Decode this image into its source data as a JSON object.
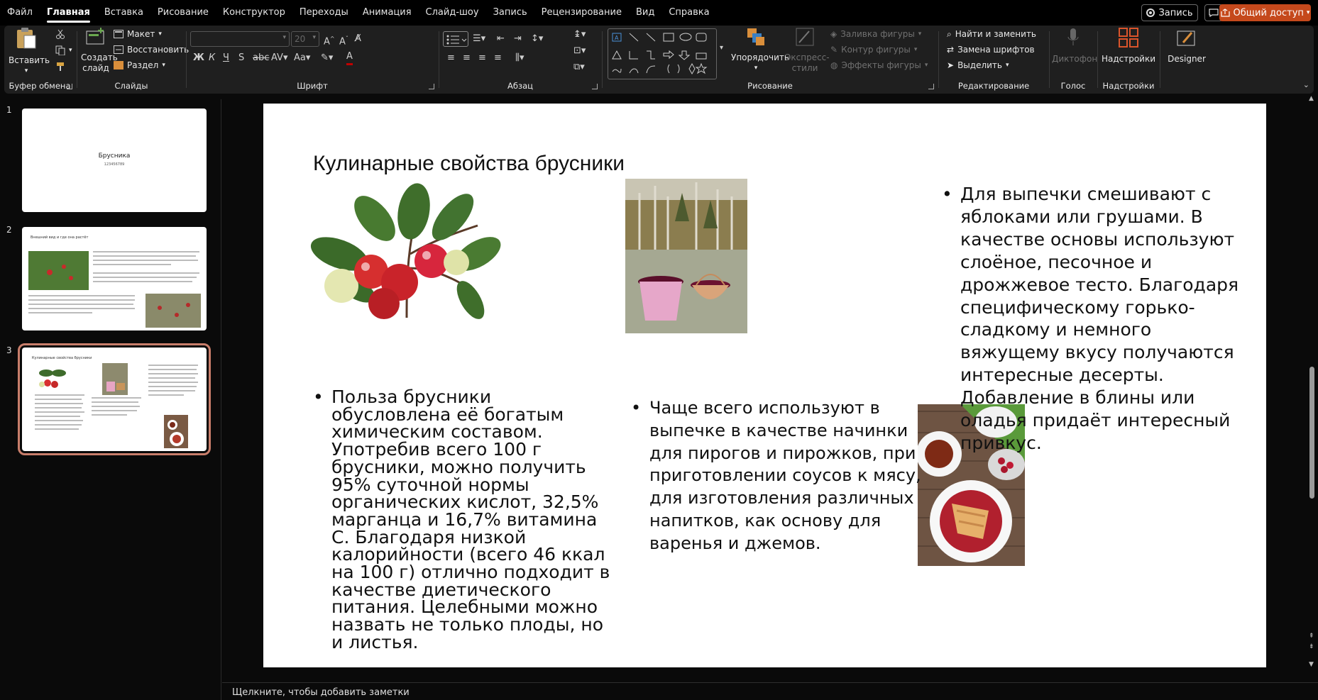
{
  "menu": {
    "tabs": [
      "Файл",
      "Главная",
      "Вставка",
      "Рисование",
      "Конструктор",
      "Переходы",
      "Анимация",
      "Слайд-шоу",
      "Запись",
      "Рецензирование",
      "Вид",
      "Справка"
    ],
    "active": "Главная",
    "record_label": "Запись",
    "share_label": "Общий доступ"
  },
  "ribbon": {
    "clipboard": {
      "paste": "Вставить",
      "label": "Буфер обмена"
    },
    "slides": {
      "new_slide": "Создать слайд",
      "layout": "Макет",
      "reset": "Восстановить",
      "section": "Раздел",
      "label": "Слайды"
    },
    "font": {
      "font_name": "",
      "font_size": "20",
      "label": "Шрифт"
    },
    "paragraph": {
      "label": "Абзац"
    },
    "drawing": {
      "arrange": "Упорядочить",
      "quick_styles": "Экспресс-стили",
      "fill": "Заливка фигуры",
      "outline": "Контур фигуры",
      "effects": "Эффекты фигуры",
      "label": "Рисование"
    },
    "editing": {
      "find_replace": "Найти и заменить",
      "replace_fonts": "Замена шрифтов",
      "select": "Выделить",
      "label": "Редактирование"
    },
    "voice": {
      "dictate": "Диктофон",
      "label": "Голос"
    },
    "addins": {
      "addins": "Надстройки",
      "label": "Надстройки"
    },
    "designer": {
      "label": "Designer"
    }
  },
  "thumbnails": [
    {
      "number": "1",
      "title": "Брусника",
      "subtitle": "123456789"
    },
    {
      "number": "2",
      "title": "Внешний вид и где она растёт"
    },
    {
      "number": "3",
      "title": "Кулинарные свойства брусники"
    }
  ],
  "slide": {
    "title": "Кулинарные свойства брусники",
    "bullet1": "Польза брусники обусловлена её богатым химическим составом. Употребив всего 100 г брусники, можно получить 95% суточной нормы органических кислот, 32,5% марганца и 16,7% витамина С. Благодаря низкой калорийности (всего 46 ккал на 100 г) отлично подходит в качестве диетического питания. Целебными можно назвать не только плоды, но и листья.",
    "bullet2": "Чаще всего используют в выпечке в качестве начинки для пирогов и пирожков, при приготовлении соусов к мясу, для изготовления различных напитков, как основу для варенья и джемов.",
    "bullet3": "Для выпечки смешивают с яблоками или грушами. В качестве основы используют слоёное, песочное и дрожжевое тесто. Благодаря специфическому горько-сладкому и немного вяжущему вкусу получаются интересные десерты. Добавление в блины или оладья придаёт интересный привкус."
  },
  "notes": {
    "placeholder": "Щелкните, чтобы добавить заметки"
  },
  "colors": {
    "accent": "#c5491c",
    "selection": "#c97e6b"
  }
}
